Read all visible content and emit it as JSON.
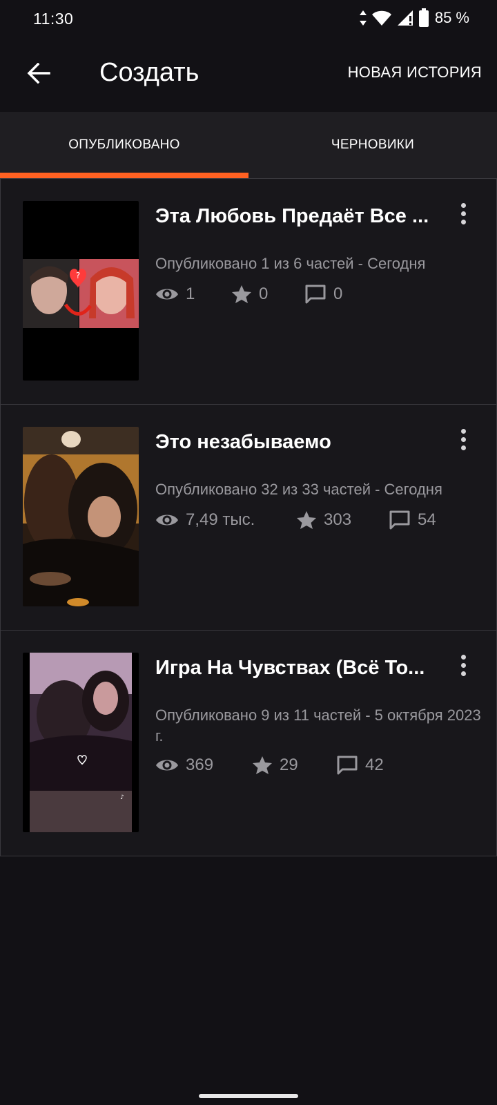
{
  "status_bar": {
    "time": "11:30",
    "battery": "85 %"
  },
  "app_bar": {
    "title": "Создать",
    "new_story_label": "НОВАЯ ИСТОРИЯ",
    "back_icon": "arrow-left-icon"
  },
  "tabs": [
    {
      "label": "ОПУБЛИКОВАНО",
      "active": true
    },
    {
      "label": "ЧЕРНОВИКИ",
      "active": false
    }
  ],
  "accent_color": "#ff6122",
  "stories": [
    {
      "title": "Эта Любовь Предаёт Все ...",
      "meta": "Опубликовано 1 из 6 частей - Сегодня",
      "views": "1",
      "votes": "0",
      "comments": "0"
    },
    {
      "title": "Это незабываемо",
      "meta": "Опубликовано 32 из 33 частей - Сегодня",
      "views": "7,49 тыс.",
      "votes": "303",
      "comments": "54"
    },
    {
      "title": "Игра На Чувствах  (Всё То...",
      "meta": "Опубликовано 9 из 11 частей - 5 октября 2023 г.",
      "views": "369",
      "votes": "29",
      "comments": "42"
    }
  ]
}
